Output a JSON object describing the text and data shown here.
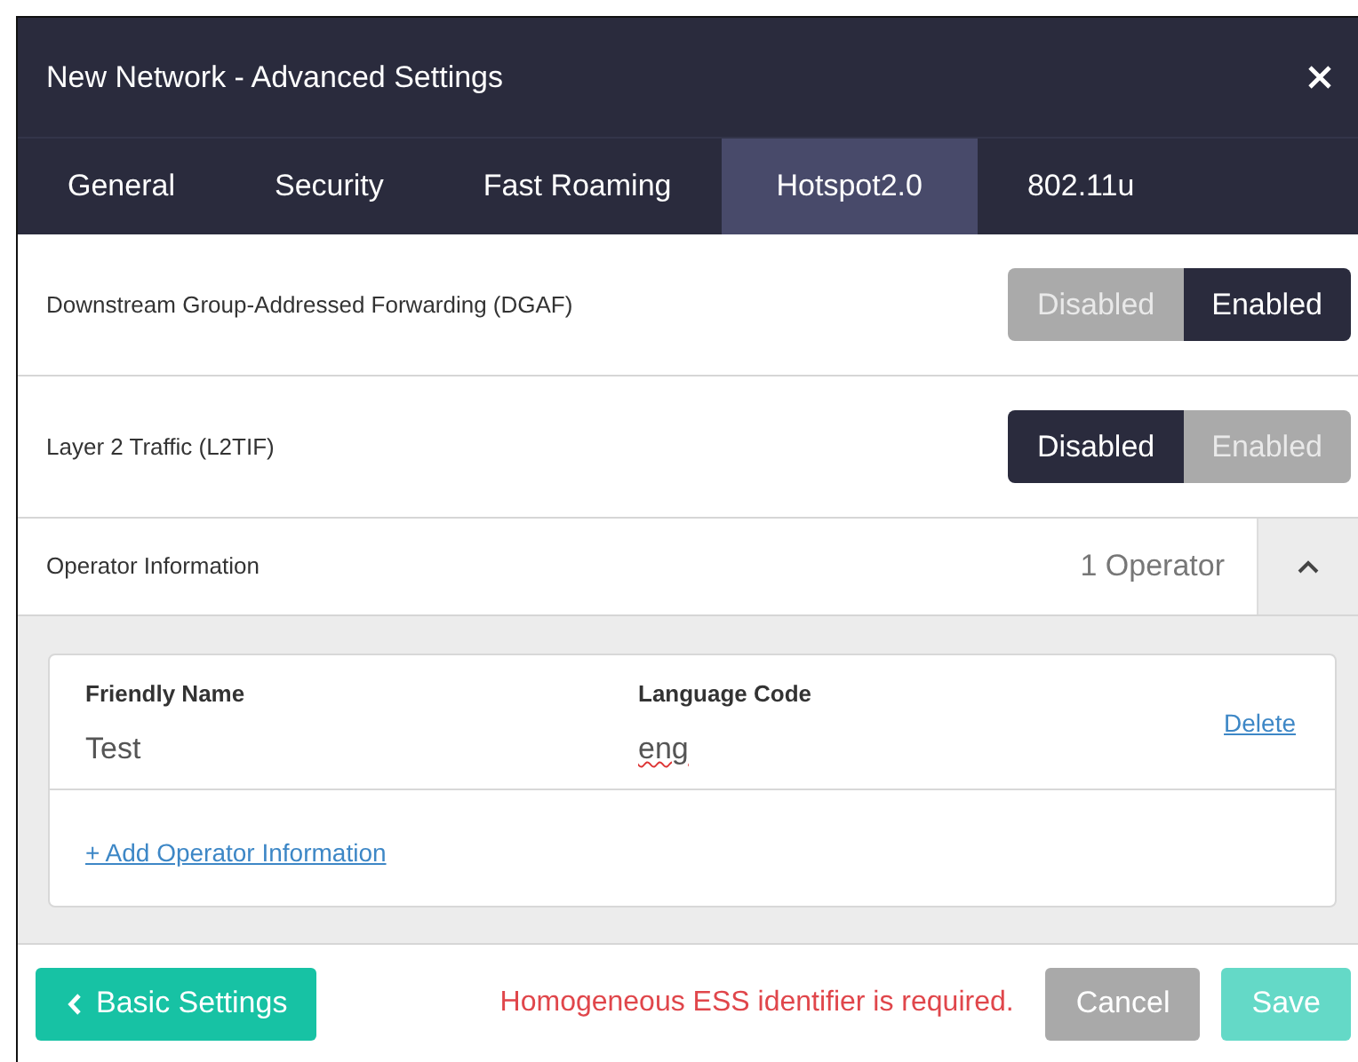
{
  "dialog": {
    "title": "New Network - Advanced Settings"
  },
  "tabs": [
    {
      "label": "General",
      "selected": false
    },
    {
      "label": "Security",
      "selected": false
    },
    {
      "label": "Fast Roaming",
      "selected": false
    },
    {
      "label": "Hotspot2.0",
      "selected": true
    },
    {
      "label": "802.11u",
      "selected": false
    }
  ],
  "settings": [
    {
      "label": "Downstream Group-Addressed Forwarding (DGAF)",
      "options": [
        {
          "label": "Disabled",
          "selected": false
        },
        {
          "label": "Enabled",
          "selected": true
        }
      ]
    },
    {
      "label": "Layer 2 Traffic (L2TIF)",
      "options": [
        {
          "label": "Disabled",
          "selected": true
        },
        {
          "label": "Enabled",
          "selected": false
        }
      ]
    }
  ],
  "operator_section": {
    "label": "Operator Information",
    "count": "1 Operator",
    "expanded": true,
    "columns": [
      "Friendly Name",
      "Language Code"
    ],
    "rows": [
      {
        "friendly_name": "Test",
        "language_code": "eng",
        "language_misspelled": true,
        "action": "Delete"
      }
    ],
    "add_link": "+ Add Operator Information"
  },
  "footer": {
    "back_button": "Basic Settings",
    "error": "Homogeneous ESS identifier is required.",
    "buttons": [
      {
        "label": "Cancel",
        "kind": "cancel",
        "disabled": false
      },
      {
        "label": "Save",
        "kind": "save",
        "disabled": true
      }
    ]
  }
}
